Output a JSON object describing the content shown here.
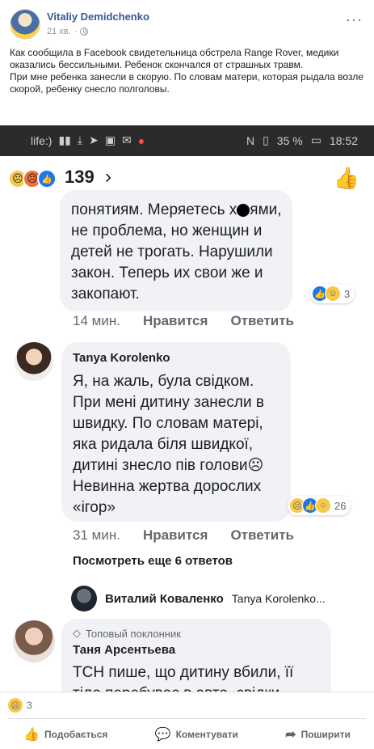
{
  "post": {
    "author": "Vitaliy Demidchenko",
    "time": "21 хв.",
    "more": "···",
    "text_p1": "Как сообщила в Facebook свидетельница обстрела Range Rover, медики оказались бессильными. Ребенок скончался от страшных травм.",
    "text_p2": "При мне ребенка занесли в скорую. По словам матери, которая рыдала возле скорой, ребенку снесло полголовы."
  },
  "screenshot": {
    "status_left": "life:)",
    "battery": "35 %",
    "clock": "18:52",
    "reactions_count": "139",
    "comment1": {
      "line1": "понятиям. Меряетесь х",
      "line1_end": "ями,",
      "rest": "не проблема, но женщин и детей не трогать. Нарушили закон. Теперь их свои же и закопают.",
      "reaction_count": "3",
      "time": "14 мин.",
      "like": "Нравится",
      "reply": "Ответить"
    },
    "comment2": {
      "author": "Tanya Korolenko",
      "text": "Я, на жаль, була свідком. При мені дитину занесли в швидку. По словам матері, яка ридала біля швидкої, дитині знесло пів голови",
      "text_end": " Невинна жертва дорослих «ігор»",
      "reaction_count": "26",
      "time": "31 мин.",
      "like": "Нравится",
      "reply": "Ответить"
    },
    "more_replies": "Посмотреть еще 6 ответов",
    "reply_preview": {
      "author": "Виталий Коваленко",
      "text": "Tanya Korolenko..."
    },
    "comment3": {
      "badge": "Топовый поклонник",
      "author": "Таня Арсентьева",
      "text": "ТСН пише, що дитину вбили, її тіло перебуває в авто, свідки"
    }
  },
  "footer": {
    "reaction_count": "3",
    "like": "Подобається",
    "comment": "Коментувати",
    "share": "Поширити"
  }
}
